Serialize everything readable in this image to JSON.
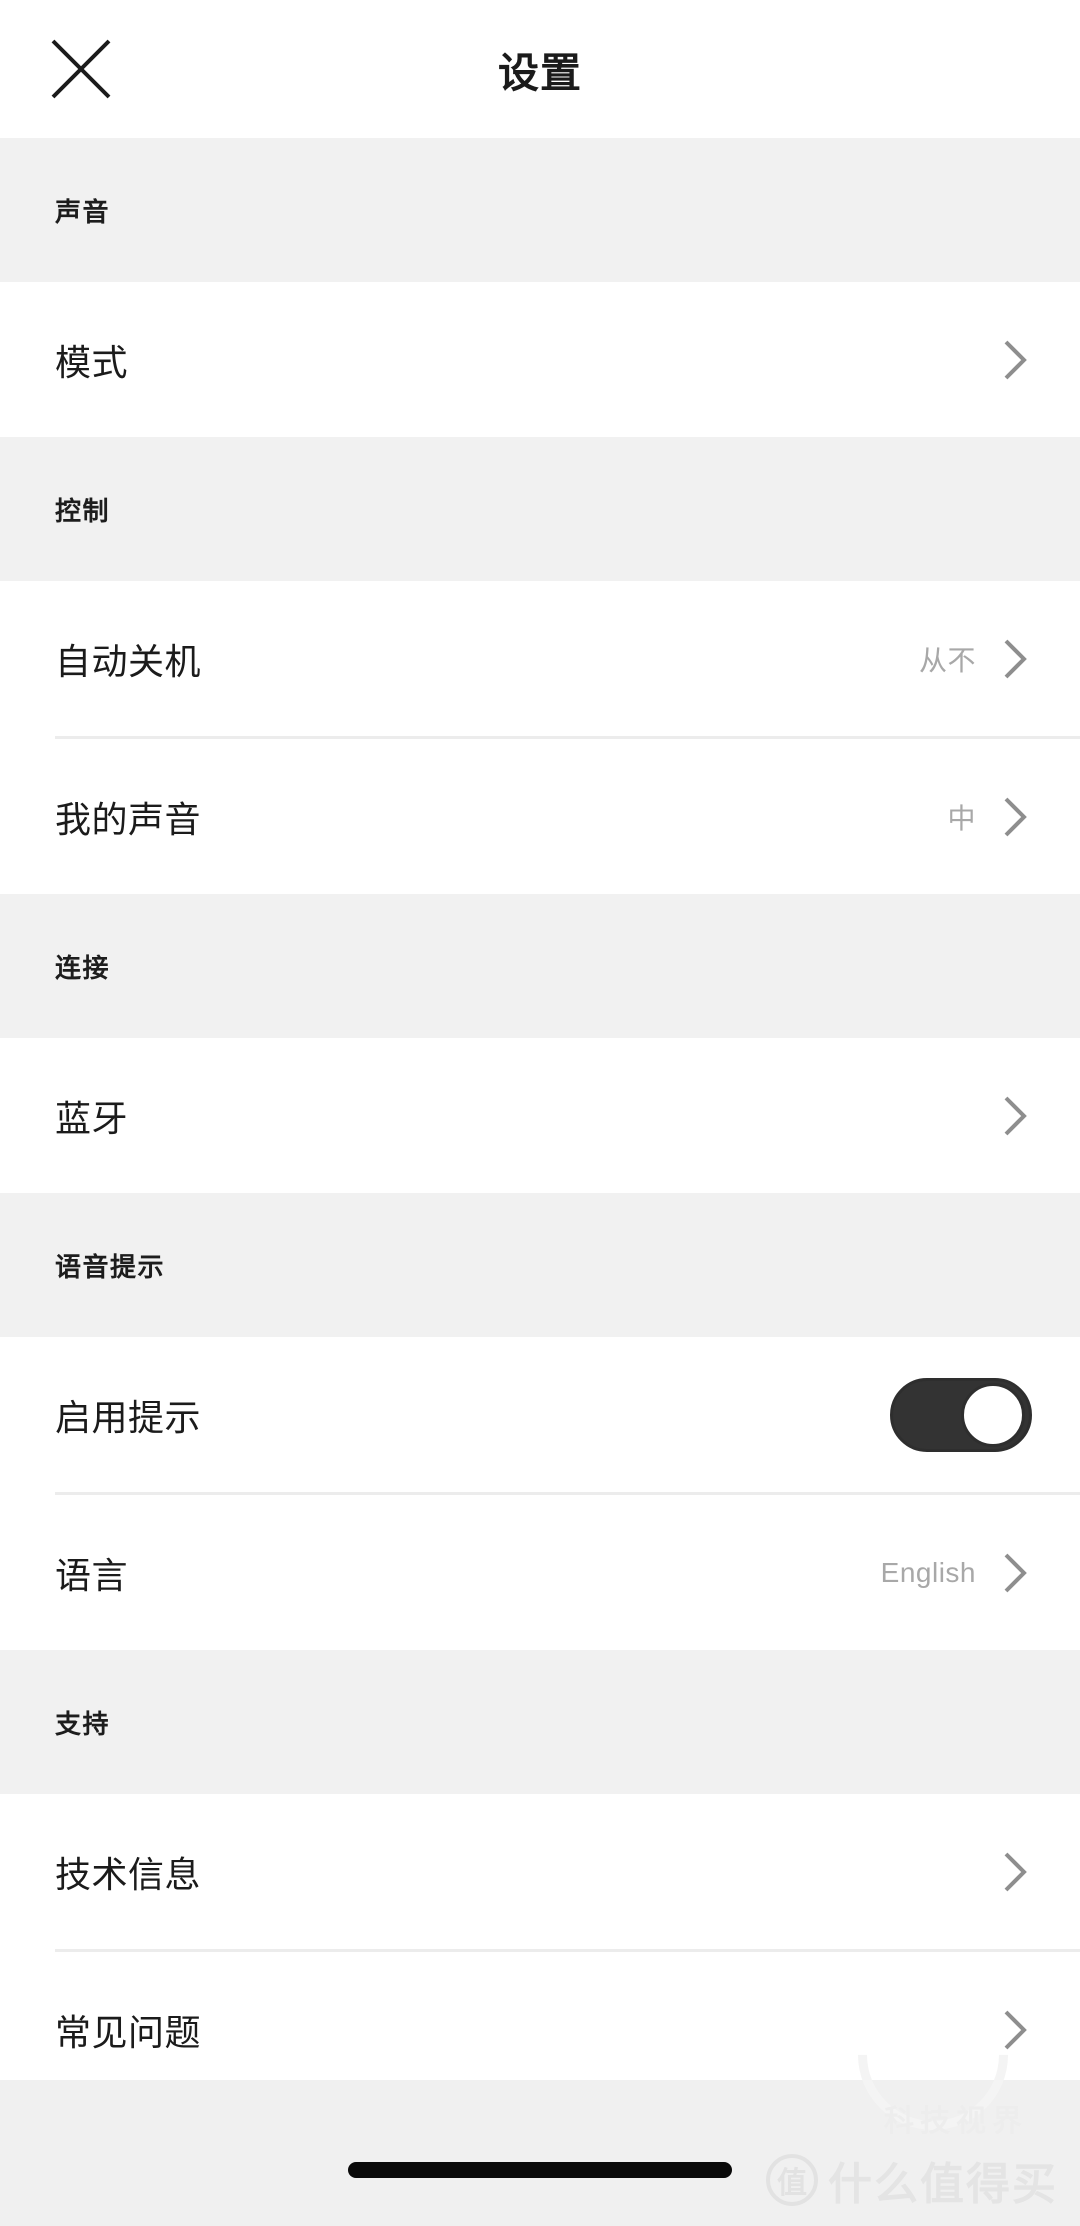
{
  "header": {
    "title": "设置",
    "close_icon": "close-x-icon"
  },
  "sections": [
    {
      "id": "sound",
      "title": "声音",
      "rows": [
        {
          "id": "mode",
          "label": "模式",
          "value": "",
          "control": "chevron"
        }
      ]
    },
    {
      "id": "control",
      "title": "控制",
      "rows": [
        {
          "id": "auto-power-off",
          "label": "自动关机",
          "value": "从不",
          "control": "chevron"
        },
        {
          "id": "my-sound",
          "label": "我的声音",
          "value": "中",
          "control": "chevron"
        }
      ]
    },
    {
      "id": "connection",
      "title": "连接",
      "rows": [
        {
          "id": "bluetooth",
          "label": "蓝牙",
          "value": "",
          "control": "chevron"
        }
      ]
    },
    {
      "id": "voice-prompts",
      "title": "语音提示",
      "rows": [
        {
          "id": "enable-prompts",
          "label": "启用提示",
          "value": "",
          "control": "toggle",
          "toggle_state": "on"
        },
        {
          "id": "language",
          "label": "语言",
          "value": "English",
          "control": "chevron"
        }
      ]
    },
    {
      "id": "support",
      "title": "支持",
      "rows": [
        {
          "id": "technical-info",
          "label": "技术信息",
          "value": "",
          "control": "chevron"
        },
        {
          "id": "faq",
          "label": "常见问题",
          "value": "",
          "control": "chevron"
        }
      ]
    }
  ],
  "watermark": {
    "badge": "值",
    "text": "什么值得买",
    "ghost": "科技视界"
  },
  "colors": {
    "section_header_bg": "#f1f1f1",
    "row_bg": "#ffffff",
    "text_primary": "#1b1b1b",
    "text_secondary": "#a8a8a8",
    "divider": "#ececec",
    "toggle_on": "#333333",
    "bottom_bar_bg": "#f0f0f0"
  }
}
